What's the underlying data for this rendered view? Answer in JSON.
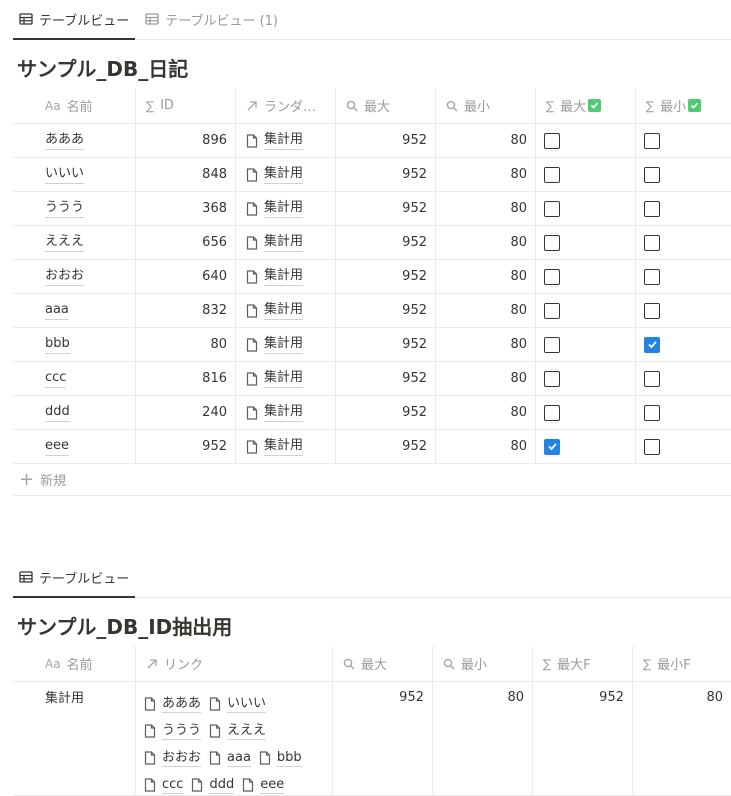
{
  "view1": {
    "tabs": [
      "テーブルビュー",
      "テーブルビュー (1)"
    ],
    "title": "サンプル_DB_日記",
    "headers": {
      "name": "名前",
      "name_prefix": "Aa",
      "id": "ID",
      "relation": "ランダ…",
      "max": "最大",
      "min": "最小",
      "max_check": "最大",
      "min_check": "最小"
    },
    "rows": [
      {
        "name": "あああ",
        "id": "896",
        "relation": "集計用",
        "max": "952",
        "min": "80",
        "max_checked": false,
        "min_checked": false
      },
      {
        "name": "いいい",
        "id": "848",
        "relation": "集計用",
        "max": "952",
        "min": "80",
        "max_checked": false,
        "min_checked": false
      },
      {
        "name": "ううう",
        "id": "368",
        "relation": "集計用",
        "max": "952",
        "min": "80",
        "max_checked": false,
        "min_checked": false
      },
      {
        "name": "えええ",
        "id": "656",
        "relation": "集計用",
        "max": "952",
        "min": "80",
        "max_checked": false,
        "min_checked": false
      },
      {
        "name": "おおお",
        "id": "640",
        "relation": "集計用",
        "max": "952",
        "min": "80",
        "max_checked": false,
        "min_checked": false
      },
      {
        "name": "aaa",
        "id": "832",
        "relation": "集計用",
        "max": "952",
        "min": "80",
        "max_checked": false,
        "min_checked": false
      },
      {
        "name": "bbb",
        "id": "80",
        "relation": "集計用",
        "max": "952",
        "min": "80",
        "max_checked": false,
        "min_checked": true
      },
      {
        "name": "ccc",
        "id": "816",
        "relation": "集計用",
        "max": "952",
        "min": "80",
        "max_checked": false,
        "min_checked": false
      },
      {
        "name": "ddd",
        "id": "240",
        "relation": "集計用",
        "max": "952",
        "min": "80",
        "max_checked": false,
        "min_checked": false
      },
      {
        "name": "eee",
        "id": "952",
        "relation": "集計用",
        "max": "952",
        "min": "80",
        "max_checked": true,
        "min_checked": false
      }
    ],
    "new_label": "新規"
  },
  "view2": {
    "tab": "テーブルビュー",
    "title": "サンプル_DB_ID抽出用",
    "headers": {
      "name": "名前",
      "name_prefix": "Aa",
      "link": "リンク",
      "max": "最大",
      "min": "最小",
      "max_f": "最大F",
      "min_f": "最小F"
    },
    "row": {
      "name": "集計用",
      "links": [
        "あああ",
        "いいい",
        "ううう",
        "えええ",
        "おおお",
        "aaa",
        "bbb",
        "ccc",
        "ddd",
        "eee"
      ],
      "max": "952",
      "min": "80",
      "max_f": "952",
      "min_f": "80"
    }
  },
  "colors": {
    "text": "#37352f",
    "muted": "#9b9a97",
    "border": "#ebebea",
    "checkbox_on": "#2383e2",
    "check_badge": "#4ecb71"
  }
}
